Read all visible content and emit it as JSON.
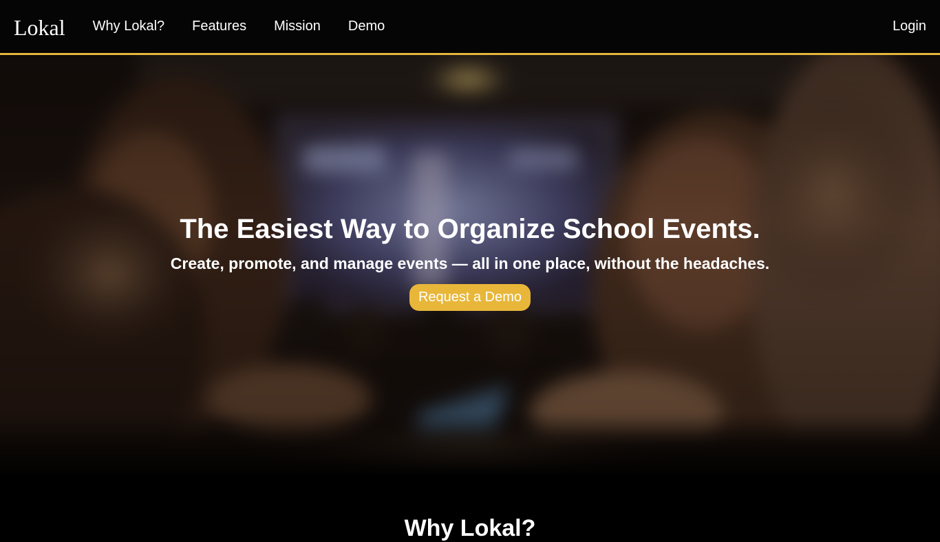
{
  "nav": {
    "brand": "Lokal",
    "links": [
      "Why Lokal?",
      "Features",
      "Mission",
      "Demo"
    ],
    "login": "Login",
    "accent_color": "#e7b73b"
  },
  "hero": {
    "title": "The Easiest Way to Organize School Events.",
    "subtitle": "Create, promote, and manage events — all in one place, without the headaches.",
    "cta_label": "Request a Demo",
    "cta_color": "#e8b73a"
  },
  "sections": {
    "why_title": "Why Lokal?"
  }
}
